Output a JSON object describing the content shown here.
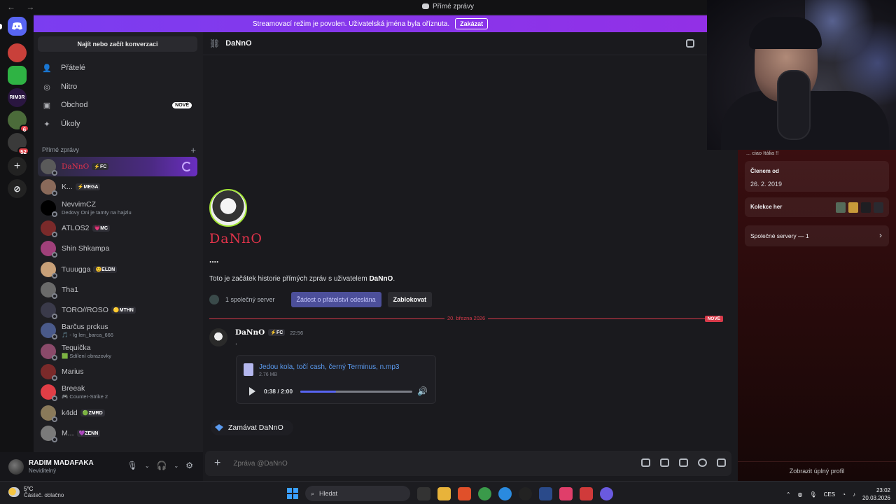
{
  "titlebar": {
    "title": "Přímé zprávy",
    "nav": "← →"
  },
  "banner": {
    "text": "Streamovací režim je povolen. Uživatelská jména byla oříznuta.",
    "button": "Zakázat"
  },
  "servers": [
    {
      "label": "",
      "color": "#5865f2"
    },
    {
      "label": "",
      "color": "#c9403a"
    },
    {
      "label": "",
      "color": "#2fb344"
    },
    {
      "label": "RIM3R",
      "color": "#2a1640"
    },
    {
      "label": "",
      "color": "#4b6b3a",
      "badge": "6"
    },
    {
      "label": "",
      "color": "#3a3a3a",
      "badge": "52"
    }
  ],
  "dm_panel": {
    "search": "Najít nebo začít konverzaci",
    "nav": [
      {
        "label": "Přátelé",
        "icon": "friends-icon",
        "glyph": "👤"
      },
      {
        "label": "Nitro",
        "icon": "nitro-icon",
        "glyph": "◎"
      },
      {
        "label": "Obchod",
        "icon": "shop-icon",
        "glyph": "▣",
        "tag": "NOVÉ"
      },
      {
        "label": "Úkoly",
        "icon": "quests-icon",
        "glyph": "✦"
      }
    ],
    "section": "Přímé zprávy",
    "dms": [
      {
        "name": "DaNnO",
        "tag": "⚡FC",
        "sub": "",
        "color": "#5a5a5a",
        "active": true
      },
      {
        "name": "K...",
        "tag": "⚡MEGA",
        "sub": "",
        "color": "#8a6a5a"
      },
      {
        "name": "NevvimCZ",
        "tag": "",
        "sub": "Dedovy Oni je tamty na hajzlu",
        "color": "#000000"
      },
      {
        "name": "ATLOS2",
        "tag": "💗MC",
        "sub": "",
        "color": "#7a2a2a"
      },
      {
        "name": "Shin Shkampa",
        "tag": "",
        "sub": "",
        "color": "#a0407a"
      },
      {
        "name": "Ƭuuugga",
        "tag": "😊ELDN",
        "sub": "",
        "color": "#c8a078"
      },
      {
        "name": "Tha1",
        "tag": "",
        "sub": "",
        "color": "#6a6a6a"
      },
      {
        "name": "TORO//ROSO",
        "tag": "🟡MTHN",
        "sub": "",
        "color": "#3a3a4a"
      },
      {
        "name": "Barčus prckus",
        "tag": "",
        "sub": "🎵 - Ig len_barca_666",
        "color": "#4a5a8a"
      },
      {
        "name": "Tequička",
        "tag": "",
        "sub": "🟩 Sdílení obrazovky",
        "color": "#8a4a6a"
      },
      {
        "name": "Marius",
        "tag": "",
        "sub": "",
        "color": "#7a2a2a"
      },
      {
        "name": "Breeak",
        "tag": "",
        "sub": "🎮 Counter-Strike 2",
        "color": "#e03e46"
      },
      {
        "name": "k4dd",
        "tag": "🟢ZMRD",
        "sub": "",
        "color": "#8a7a5a"
      },
      {
        "name": "M...",
        "tag": "💜ZENN",
        "sub": "",
        "color": "#7a7a7a"
      }
    ]
  },
  "user": {
    "name": "RADIM MADAFAKA",
    "status": "Neviditelný"
  },
  "chat": {
    "header_name": "DaNnO",
    "profile_name": "DaNnO",
    "dots": "....",
    "begin_prefix": "Toto je začátek historie přímých zpráv s uživatelem ",
    "begin_name": "DaNnO",
    "begin_suffix": ".",
    "mutual": "1 společný server",
    "request_btn": "Žádost o přátelství odeslána",
    "block_btn": "Zablokovat",
    "divider_date": "20. března 2026",
    "divider_new": "NOVÉ",
    "message": {
      "author": "DaNnO",
      "tag": "⚡FC",
      "time": "22:56",
      "text": ".",
      "attachment": {
        "name": "Jedou kola, točí cash, černý Terminus, n.mp3",
        "size": "2.76 MB",
        "time": "0:38 / 2:00",
        "progress": 0.32
      }
    },
    "wave_text": "Zamávat DaNnO",
    "composer_placeholder": "Zpráva @DaNnO"
  },
  "profile": {
    "top": "... ciao Itália !!",
    "member_label": "Členem od",
    "member_value": "26. 2. 2019",
    "games_label": "Kolekce her",
    "mutual_label": "Společné servery — 1",
    "more": "Zobrazit úplný profil"
  },
  "taskbar": {
    "temp": "5°C",
    "weather": "Částeč. oblačno",
    "search": "Hledat",
    "lang": "CES",
    "time": "23:02",
    "date": "20.03.2026"
  }
}
